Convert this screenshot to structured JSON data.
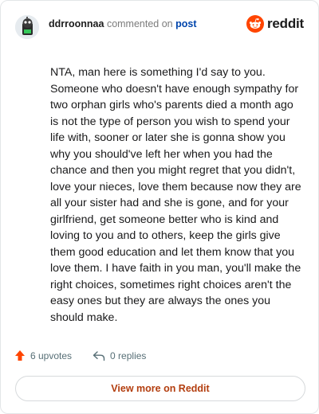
{
  "header": {
    "username": "ddrroonnaa",
    "action_text": "commented on",
    "post_link": "post",
    "brand": "reddit"
  },
  "comment": {
    "body": "NTA, man here is something I'd say to you. Someone who doesn't have enough sympathy for two orphan girls who's parents died a month ago is not the type of person you wish to spend your life with, sooner or later she is gonna show you why you should've left her when you had the chance and then you might regret that you didn't, love your nieces, love them because now they are all your sister had and she is gone, and for your girlfriend, get someone better who is kind and loving to you and to others, keep the girls give them good education and let them know that you love them. I have faith in you man, you'll make the right choices, sometimes right choices aren't the easy ones but they are always the ones you should make."
  },
  "actions": {
    "upvotes": "6 upvotes",
    "replies": "0 replies"
  },
  "footer": {
    "view_more": "View more on Reddit"
  },
  "icons": [
    "avatar",
    "reddit-logo-icon",
    "upvote-arrow-icon",
    "reply-arrow-icon"
  ],
  "colors": {
    "upvote": "#ff4500",
    "link": "#0045ac",
    "view_more_text": "#b33e0f",
    "reddit_orange": "#ff4500"
  }
}
